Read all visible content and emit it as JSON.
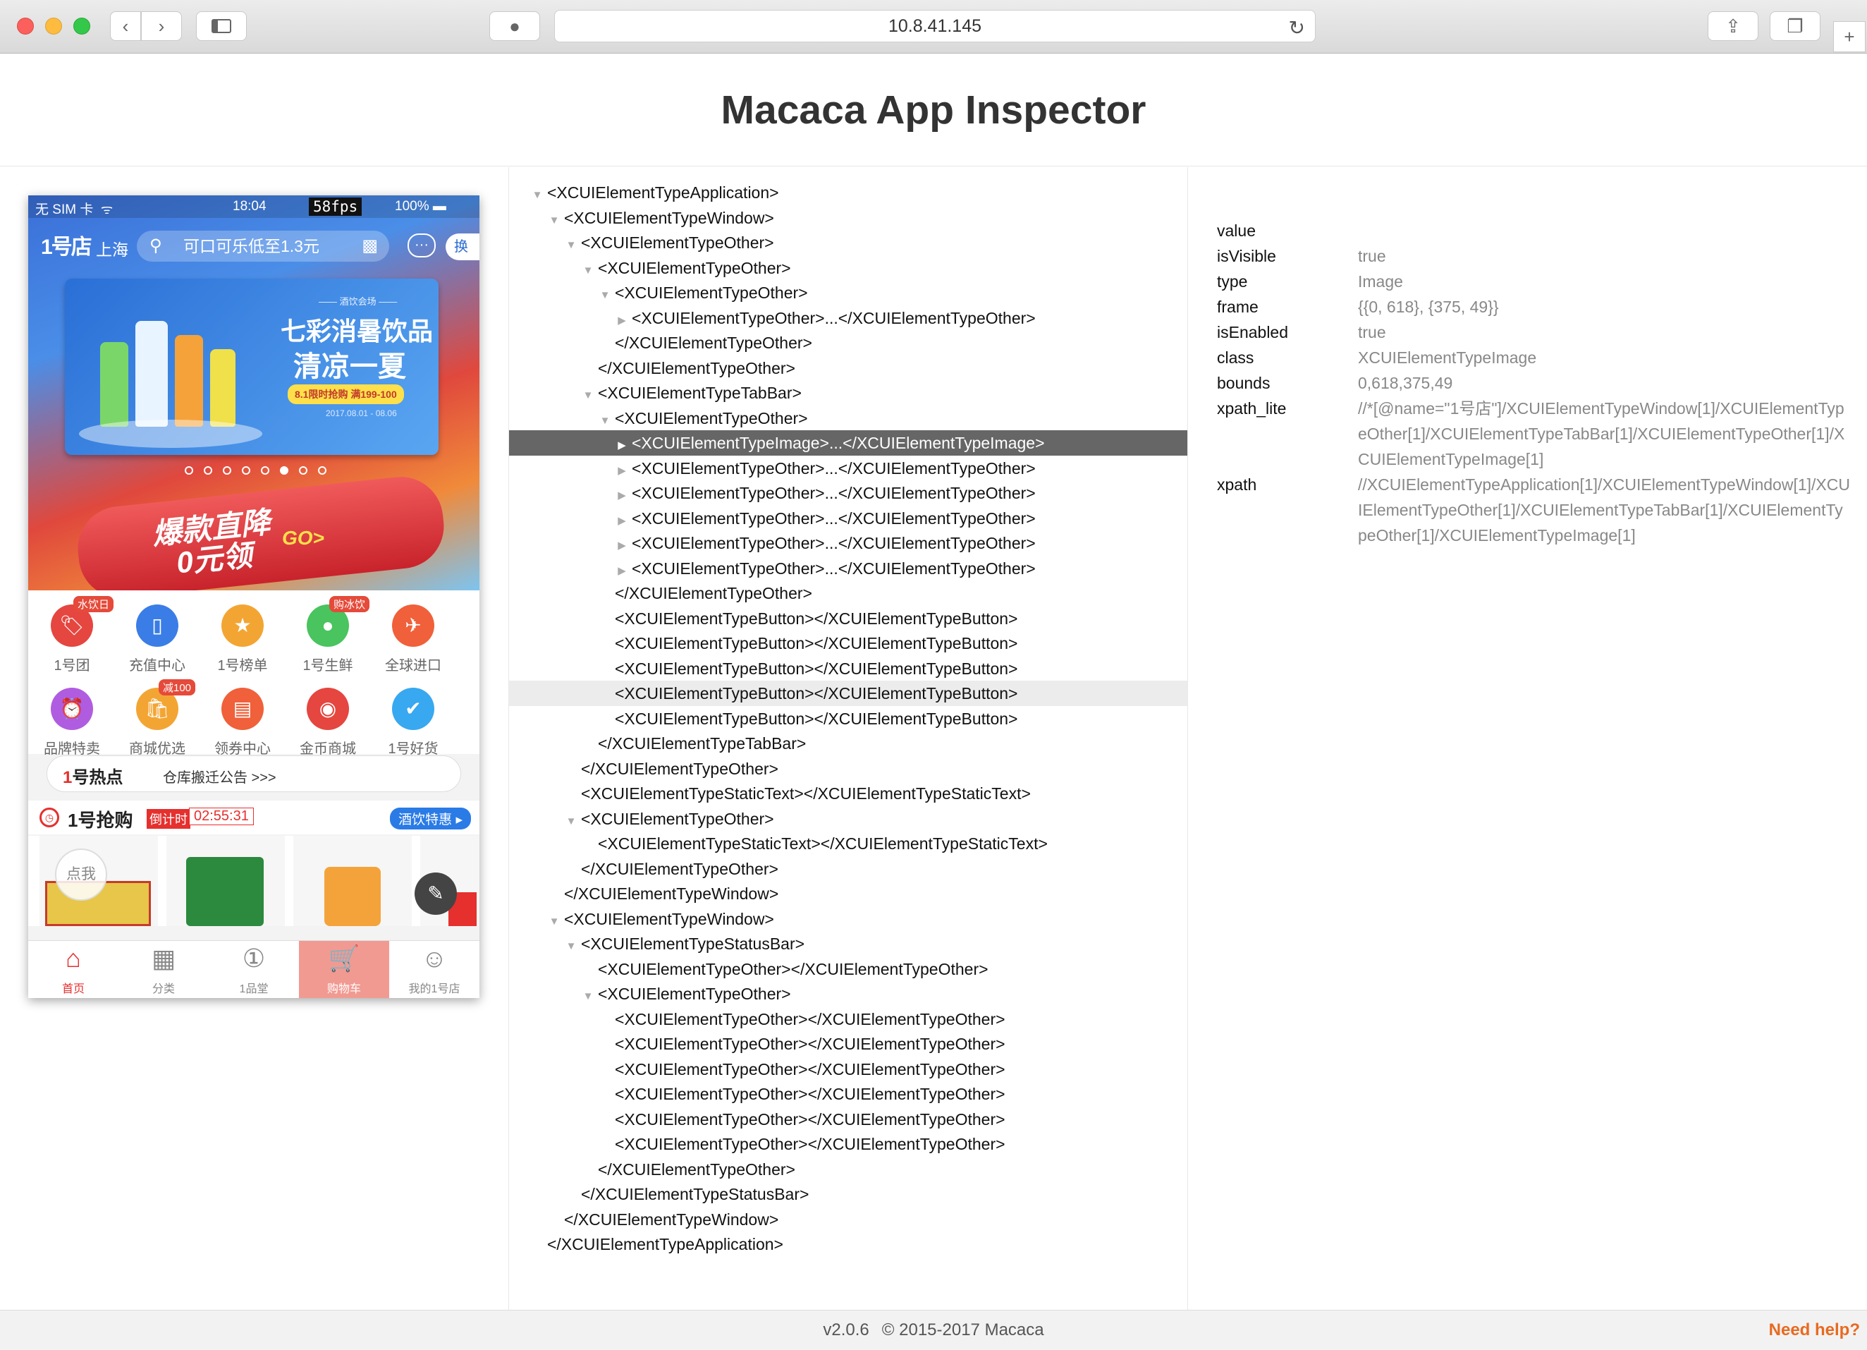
{
  "browser": {
    "url": "10.8.41.145"
  },
  "page": {
    "title": "Macaca App Inspector"
  },
  "tree": [
    {
      "indent": 0,
      "toggle": "open",
      "text": "<XCUIElementTypeApplication>"
    },
    {
      "indent": 1,
      "toggle": "open",
      "text": "<XCUIElementTypeWindow>"
    },
    {
      "indent": 2,
      "toggle": "open",
      "text": "<XCUIElementTypeOther>"
    },
    {
      "indent": 3,
      "toggle": "open",
      "text": "<XCUIElementTypeOther>"
    },
    {
      "indent": 4,
      "toggle": "open",
      "text": "<XCUIElementTypeOther>"
    },
    {
      "indent": 5,
      "toggle": "closed",
      "text": "<XCUIElementTypeOther>...</XCUIElementTypeOther>"
    },
    {
      "indent": 4,
      "toggle": "none",
      "text": "</XCUIElementTypeOther>"
    },
    {
      "indent": 3,
      "toggle": "none",
      "text": "</XCUIElementTypeOther>"
    },
    {
      "indent": 3,
      "toggle": "open",
      "text": "<XCUIElementTypeTabBar>"
    },
    {
      "indent": 4,
      "toggle": "open",
      "text": "<XCUIElementTypeOther>"
    },
    {
      "indent": 5,
      "toggle": "closed",
      "text": "<XCUIElementTypeImage>...</XCUIElementTypeImage>",
      "state": "selected"
    },
    {
      "indent": 5,
      "toggle": "closed",
      "text": "<XCUIElementTypeOther>...</XCUIElementTypeOther>"
    },
    {
      "indent": 5,
      "toggle": "closed",
      "text": "<XCUIElementTypeOther>...</XCUIElementTypeOther>"
    },
    {
      "indent": 5,
      "toggle": "closed",
      "text": "<XCUIElementTypeOther>...</XCUIElementTypeOther>"
    },
    {
      "indent": 5,
      "toggle": "closed",
      "text": "<XCUIElementTypeOther>...</XCUIElementTypeOther>"
    },
    {
      "indent": 5,
      "toggle": "closed",
      "text": "<XCUIElementTypeOther>...</XCUIElementTypeOther>"
    },
    {
      "indent": 4,
      "toggle": "none",
      "text": "</XCUIElementTypeOther>"
    },
    {
      "indent": 4,
      "toggle": "none",
      "text": "<XCUIElementTypeButton></XCUIElementTypeButton>"
    },
    {
      "indent": 4,
      "toggle": "none",
      "text": "<XCUIElementTypeButton></XCUIElementTypeButton>"
    },
    {
      "indent": 4,
      "toggle": "none",
      "text": "<XCUIElementTypeButton></XCUIElementTypeButton>"
    },
    {
      "indent": 4,
      "toggle": "none",
      "text": "<XCUIElementTypeButton></XCUIElementTypeButton>",
      "state": "hover"
    },
    {
      "indent": 4,
      "toggle": "none",
      "text": "<XCUIElementTypeButton></XCUIElementTypeButton>"
    },
    {
      "indent": 3,
      "toggle": "none",
      "text": "</XCUIElementTypeTabBar>"
    },
    {
      "indent": 2,
      "toggle": "none",
      "text": "</XCUIElementTypeOther>"
    },
    {
      "indent": 2,
      "toggle": "none",
      "text": "<XCUIElementTypeStaticText></XCUIElementTypeStaticText>"
    },
    {
      "indent": 2,
      "toggle": "open",
      "text": "<XCUIElementTypeOther>"
    },
    {
      "indent": 3,
      "toggle": "none",
      "text": "<XCUIElementTypeStaticText></XCUIElementTypeStaticText>"
    },
    {
      "indent": 2,
      "toggle": "none",
      "text": "</XCUIElementTypeOther>"
    },
    {
      "indent": 1,
      "toggle": "none",
      "text": "</XCUIElementTypeWindow>"
    },
    {
      "indent": 1,
      "toggle": "open",
      "text": "<XCUIElementTypeWindow>"
    },
    {
      "indent": 2,
      "toggle": "open",
      "text": "<XCUIElementTypeStatusBar>"
    },
    {
      "indent": 3,
      "toggle": "none",
      "text": "<XCUIElementTypeOther></XCUIElementTypeOther>"
    },
    {
      "indent": 3,
      "toggle": "open",
      "text": "<XCUIElementTypeOther>"
    },
    {
      "indent": 4,
      "toggle": "none",
      "text": "<XCUIElementTypeOther></XCUIElementTypeOther>"
    },
    {
      "indent": 4,
      "toggle": "none",
      "text": "<XCUIElementTypeOther></XCUIElementTypeOther>"
    },
    {
      "indent": 4,
      "toggle": "none",
      "text": "<XCUIElementTypeOther></XCUIElementTypeOther>"
    },
    {
      "indent": 4,
      "toggle": "none",
      "text": "<XCUIElementTypeOther></XCUIElementTypeOther>"
    },
    {
      "indent": 4,
      "toggle": "none",
      "text": "<XCUIElementTypeOther></XCUIElementTypeOther>"
    },
    {
      "indent": 4,
      "toggle": "none",
      "text": "<XCUIElementTypeOther></XCUIElementTypeOther>"
    },
    {
      "indent": 3,
      "toggle": "none",
      "text": "</XCUIElementTypeOther>"
    },
    {
      "indent": 2,
      "toggle": "none",
      "text": "</XCUIElementTypeStatusBar>"
    },
    {
      "indent": 1,
      "toggle": "none",
      "text": "</XCUIElementTypeWindow>"
    },
    {
      "indent": 0,
      "toggle": "none",
      "text": "</XCUIElementTypeApplication>"
    }
  ],
  "properties": [
    {
      "key": "value",
      "value": ""
    },
    {
      "key": "isVisible",
      "value": "true"
    },
    {
      "key": "type",
      "value": "Image"
    },
    {
      "key": "frame",
      "value": "{{0, 618}, {375, 49}}"
    },
    {
      "key": "isEnabled",
      "value": "true"
    },
    {
      "key": "class",
      "value": "XCUIElementTypeImage"
    },
    {
      "key": "bounds",
      "value": "0,618,375,49"
    },
    {
      "key": "xpath_lite",
      "value": "//*[@name=\"1号店\"]/XCUIElementTypeWindow[1]/XCUIElementTypeOther[1]/XCUIElementTypeTabBar[1]/XCUIElementTypeOther[1]/XCUIElementTypeImage[1]"
    },
    {
      "key": "xpath",
      "value": "//XCUIElementTypeApplication[1]/XCUIElementTypeWindow[1]/XCUIElementTypeOther[1]/XCUIElementTypeTabBar[1]/XCUIElementTypeOther[1]/XCUIElementTypeImage[1]"
    }
  ],
  "footer": {
    "version": "v2.0.6",
    "copyright": "© 2015-2017 Macaca",
    "help": "Need help?"
  },
  "phone": {
    "status": {
      "carrier": "无 SIM 卡 ︎ ᯤ",
      "time": "18:04",
      "fps": "58fps",
      "battery": "100% ▬"
    },
    "logo": "1号店",
    "city": "上海",
    "search_placeholder": "可口可乐低至1.3元",
    "swap": "换",
    "banner": {
      "tag": "—— 酒饮会场 ——",
      "title1": "七彩消暑饮品",
      "title2": "清凉一夏",
      "pill": "8.1限时抢购 满199-100",
      "date": "2017.08.01 - 08.06"
    },
    "promo": {
      "line1": "爆款直降",
      "line2": "0元领",
      "go": "GO>"
    },
    "icons": [
      {
        "label": "1号团",
        "badge": "水饮日",
        "color": "#e5463f",
        "glyph": "🏷"
      },
      {
        "label": "充值中心",
        "badge": "",
        "color": "#3b7de6",
        "glyph": "▯"
      },
      {
        "label": "1号榜单",
        "badge": "",
        "color": "#f3a533",
        "glyph": "★"
      },
      {
        "label": "1号生鲜",
        "badge": "购冰饮",
        "color": "#49c45e",
        "glyph": "●"
      },
      {
        "label": "全球进口",
        "badge": "",
        "color": "#f0603a",
        "glyph": "✈"
      },
      {
        "label": "品牌特卖",
        "badge": "",
        "color": "#b05ce0",
        "glyph": "⏰"
      },
      {
        "label": "商城优选",
        "badge": "减100",
        "color": "#f3a533",
        "glyph": "🛍"
      },
      {
        "label": "领券中心",
        "badge": "",
        "color": "#f0603a",
        "glyph": "▤"
      },
      {
        "label": "金币商城",
        "badge": "",
        "color": "#e5463f",
        "glyph": "◉"
      },
      {
        "label": "1号好货",
        "badge": "",
        "color": "#38a8f0",
        "glyph": "✔"
      }
    ],
    "news": {
      "brand_num": "1",
      "brand": "号热点",
      "text": "仓库搬迁公告 >>>"
    },
    "flash": {
      "title": "1号抢购",
      "label": "倒计时",
      "time": "02:55:31",
      "tag": "酒饮特惠 ▸"
    },
    "tapme": "点我",
    "tabs": [
      {
        "label": "首页",
        "glyph": "⌂"
      },
      {
        "label": "分类",
        "glyph": "▦"
      },
      {
        "label": "1品堂",
        "glyph": "①"
      },
      {
        "label": "购物车",
        "glyph": "🛒"
      },
      {
        "label": "我的1号店",
        "glyph": "☺"
      }
    ]
  }
}
